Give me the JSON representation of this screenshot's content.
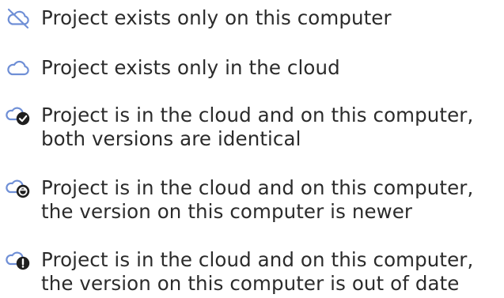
{
  "colors": {
    "cloud_outline": "#6f8fd6",
    "badge_fill": "#1f1f1f",
    "text": "#2b2b2b"
  },
  "legend": {
    "items": [
      {
        "icon": "cloud-off-icon",
        "lines": [
          "Project exists only on this computer"
        ]
      },
      {
        "icon": "cloud-icon",
        "lines": [
          "Project exists only in the cloud"
        ]
      },
      {
        "icon": "cloud-synced-icon",
        "lines": [
          "Project is in the cloud and on this computer,",
          "both versions are identical"
        ]
      },
      {
        "icon": "cloud-newer-icon",
        "lines": [
          "Project is in the cloud and on this computer,",
          "the version on this computer is newer"
        ]
      },
      {
        "icon": "cloud-outdated-icon",
        "lines": [
          "Project is in the cloud and on this computer,",
          "the version on this computer is out of date"
        ]
      }
    ]
  }
}
